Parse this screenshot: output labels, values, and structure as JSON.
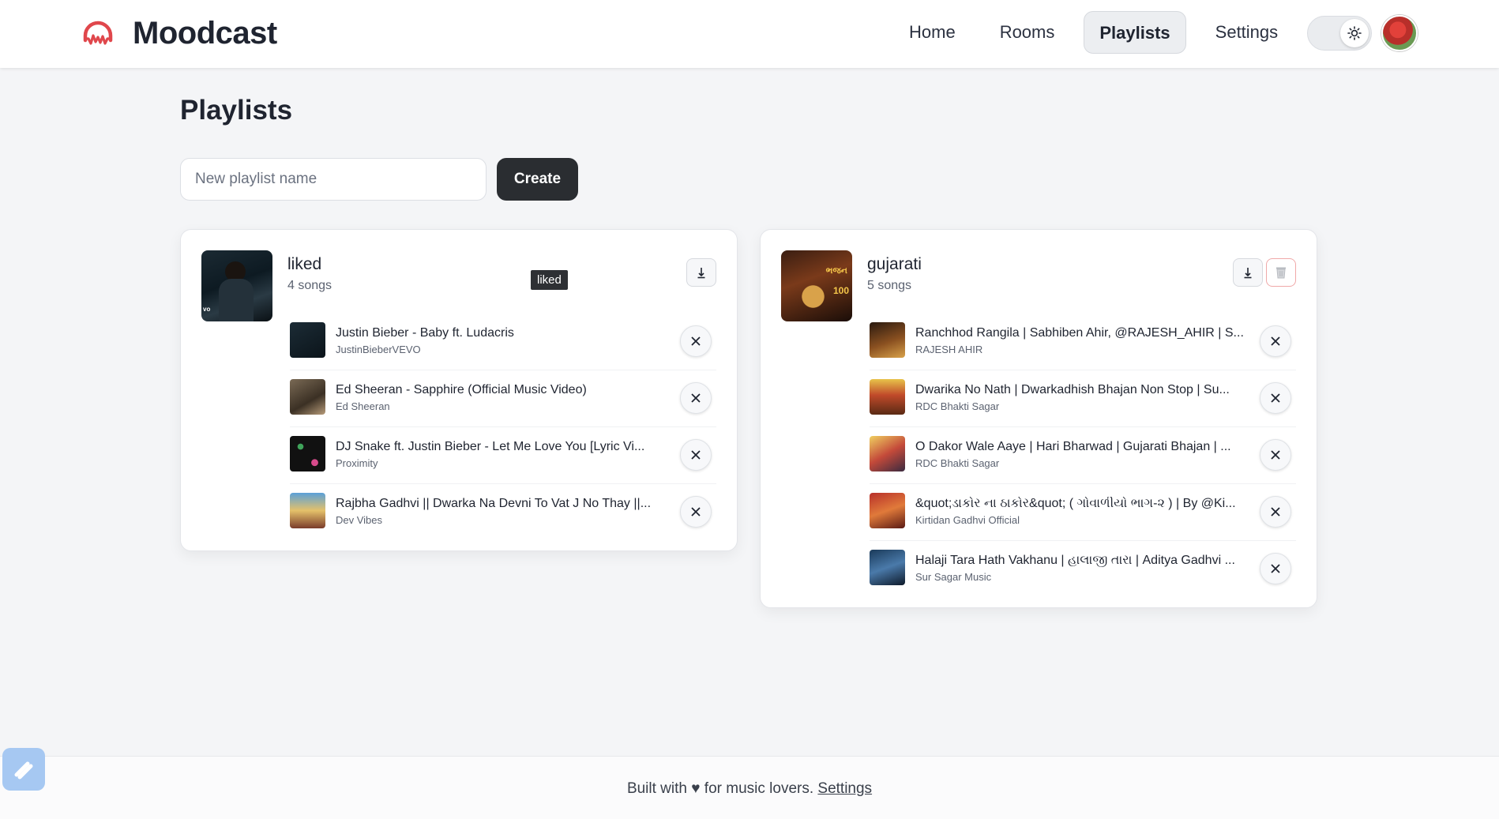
{
  "app": {
    "name": "Moodcast"
  },
  "nav": {
    "items": [
      {
        "label": "Home",
        "active": false
      },
      {
        "label": "Rooms",
        "active": false
      },
      {
        "label": "Playlists",
        "active": true
      },
      {
        "label": "Settings",
        "active": false
      }
    ],
    "theme_icon": "sun-icon"
  },
  "page": {
    "title": "Playlists",
    "new_playlist_placeholder": "New playlist name",
    "new_playlist_value": "",
    "create_label": "Create"
  },
  "playlists": [
    {
      "name": "liked",
      "count": "4 songs",
      "tooltip": "liked",
      "songs": [
        {
          "title": "Justin Bieber - Baby ft. Ludacris",
          "artist": "JustinBieberVEVO"
        },
        {
          "title": "Ed Sheeran - Sapphire (Official Music Video)",
          "artist": "Ed Sheeran"
        },
        {
          "title": "DJ Snake ft. Justin Bieber - Let Me Love You [Lyric Vi...",
          "artist": "Proximity"
        },
        {
          "title": "Rajbha Gadhvi || Dwarka Na Devni To Vat J No Thay ||...",
          "artist": "Dev Vibes"
        }
      ]
    },
    {
      "name": "gujarati",
      "count": "5 songs",
      "songs": [
        {
          "title": "Ranchhod Rangila | Sabhiben Ahir, @RAJESH_AHIR | S...",
          "artist": "RAJESH AHIR"
        },
        {
          "title": "Dwarika No Nath | Dwarkadhish Bhajan Non Stop | Su...",
          "artist": "RDC Bhakti Sagar"
        },
        {
          "title": "O Dakor Wale Aaye | Hari Bharwad | Gujarati Bhajan | ...",
          "artist": "RDC Bhakti Sagar"
        },
        {
          "title": "&quot;ડાકોર ના ઠાકોર&quot; ( ગોવાળીયો ભાગ-૨ ) | By @Ki...",
          "artist": "Kirtidan Gadhvi Official"
        },
        {
          "title": "Halaji Tara Hath Vakhanu | હાલાજી તારા | Aditya Gadhvi ...",
          "artist": "Sur Sagar Music"
        }
      ]
    }
  ],
  "footer": {
    "text": "Built with ♥ for music lovers.",
    "link": "Settings"
  }
}
